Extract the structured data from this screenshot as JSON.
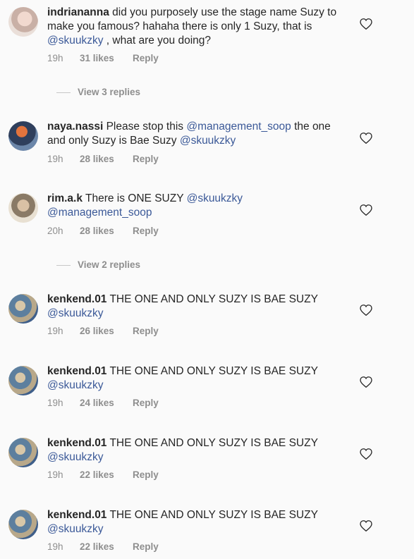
{
  "comments": [
    {
      "username": "indriananna",
      "segments": [
        {
          "text": " did you purposely use the stage name Suzy to make you famous? hahaha there is only 1 Suzy, that is ",
          "mention": false
        },
        {
          "text": "@skuukzky",
          "mention": true
        },
        {
          "text": " , what are you doing?",
          "mention": false
        }
      ],
      "time": "19h",
      "likes": "31 likes",
      "reply": "Reply",
      "view_replies": "View 3 replies"
    },
    {
      "username": "naya.nassi",
      "segments": [
        {
          "text": " Please stop this ",
          "mention": false
        },
        {
          "text": "@management_soop",
          "mention": true
        },
        {
          "text": " the one and only Suzy is Bae Suzy ",
          "mention": false
        },
        {
          "text": "@skuukzky",
          "mention": true
        }
      ],
      "time": "19h",
      "likes": "28 likes",
      "reply": "Reply"
    },
    {
      "username": "rim.a.k",
      "segments": [
        {
          "text": " There is ONE SUZY ",
          "mention": false
        },
        {
          "text": "@skuukzky",
          "mention": true
        },
        {
          "text": " ",
          "mention": false
        },
        {
          "text": "@management_soop",
          "mention": true
        }
      ],
      "time": "20h",
      "likes": "28 likes",
      "reply": "Reply",
      "view_replies": "View 2 replies"
    },
    {
      "username": "kenkend.01",
      "segments": [
        {
          "text": " THE ONE AND ONLY SUZY IS BAE SUZY ",
          "mention": false
        },
        {
          "text": "@skuukzky",
          "mention": true
        }
      ],
      "time": "19h",
      "likes": "26 likes",
      "reply": "Reply"
    },
    {
      "username": "kenkend.01",
      "segments": [
        {
          "text": " THE ONE AND ONLY SUZY IS BAE SUZY ",
          "mention": false
        },
        {
          "text": "@skuukzky",
          "mention": true
        }
      ],
      "time": "19h",
      "likes": "24 likes",
      "reply": "Reply"
    },
    {
      "username": "kenkend.01",
      "segments": [
        {
          "text": " THE ONE AND ONLY SUZY IS BAE SUZY ",
          "mention": false
        },
        {
          "text": "@skuukzky",
          "mention": true
        }
      ],
      "time": "19h",
      "likes": "22 likes",
      "reply": "Reply"
    },
    {
      "username": "kenkend.01",
      "segments": [
        {
          "text": " THE ONE AND ONLY SUZY IS BAE SUZY ",
          "mention": false
        },
        {
          "text": "@skuukzky",
          "mention": true
        }
      ],
      "time": "19h",
      "likes": "22 likes",
      "reply": "Reply"
    }
  ]
}
